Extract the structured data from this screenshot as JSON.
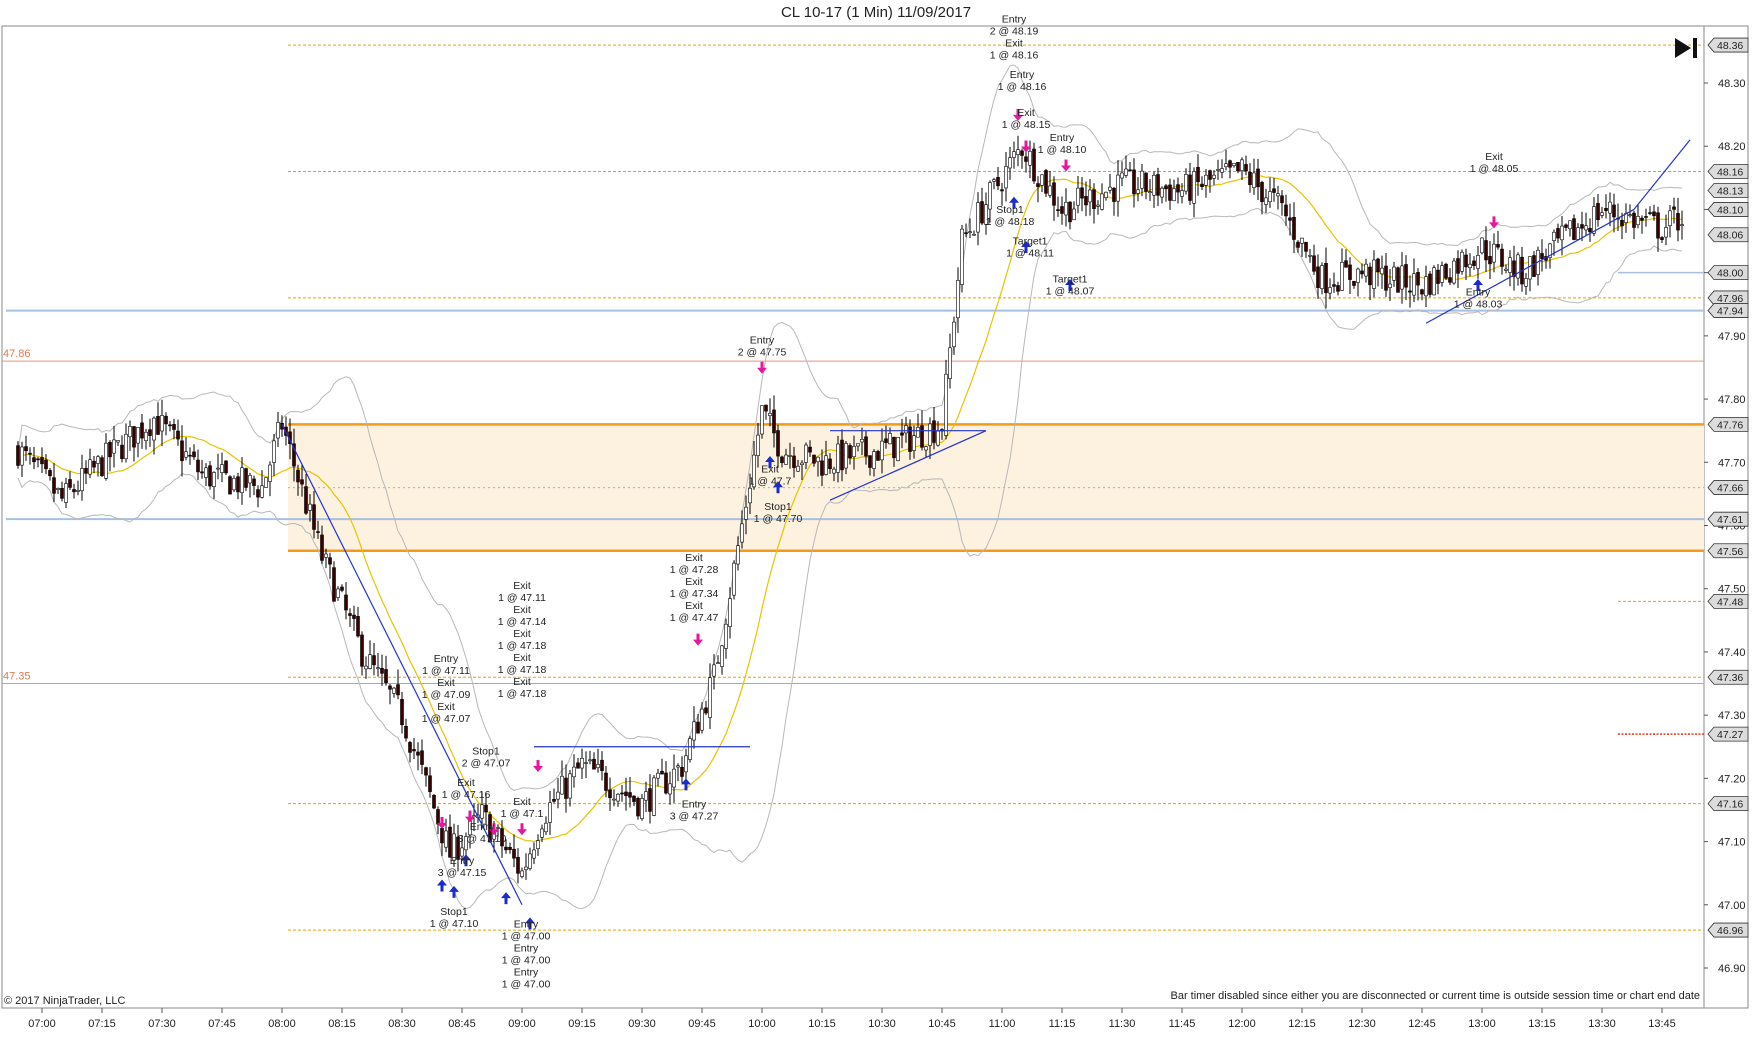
{
  "window": {
    "title": "CL 10-17 (1 Min)  11/09/2017",
    "copyright": "© 2017 NinjaTrader, LLC",
    "bar_timer_note": "Bar timer disabled since either you are disconnected or current time is outside session time or chart end date"
  },
  "colors": {
    "up_candle": "#ffffff",
    "down_candle": "#3a0000",
    "wick": "#000000",
    "bollinger": "#b8b8b8",
    "ma": "#e6c400",
    "trendline": "#2233cc",
    "entry_arrow_down": "#e6169f",
    "entry_arrow_up": "#1a2ccc",
    "zone_fill": "#fdf1e0",
    "zone_border": "#f29a1a",
    "level_orange_dotted": "#e8a400",
    "level_red_solid": "#e8957a",
    "level_blue": "#a8c0e0"
  },
  "chart_data": {
    "type": "candlestick",
    "title": "CL 10-17 (1 Min)  11/09/2017",
    "xlabel": "",
    "ylabel": "",
    "x_range": [
      "06:54",
      "14:00"
    ],
    "ylim": [
      46.86,
      48.39
    ],
    "x_ticks": [
      "07:00",
      "07:15",
      "07:30",
      "07:45",
      "08:00",
      "08:15",
      "08:30",
      "08:45",
      "09:00",
      "09:15",
      "09:30",
      "09:45",
      "10:00",
      "10:15",
      "10:30",
      "10:45",
      "11:00",
      "11:15",
      "11:30",
      "11:45",
      "12:00",
      "12:15",
      "12:30",
      "12:45",
      "13:00",
      "13:15",
      "13:30",
      "13:45"
    ],
    "y_ticks": [
      "46.90",
      "47.00",
      "47.10",
      "47.20",
      "47.30",
      "47.40",
      "47.50",
      "47.60",
      "47.70",
      "47.80",
      "47.90",
      "48.00",
      "48.10",
      "48.20",
      "48.30"
    ],
    "price_keypoints": [
      [
        "06:54",
        47.72
      ],
      [
        "07:05",
        47.64
      ],
      [
        "07:15",
        47.7
      ],
      [
        "07:28",
        47.77
      ],
      [
        "07:40",
        47.68
      ],
      [
        "07:55",
        47.66
      ],
      [
        "08:00",
        47.76
      ],
      [
        "08:10",
        47.55
      ],
      [
        "08:20",
        47.4
      ],
      [
        "08:30",
        47.3
      ],
      [
        "08:42",
        47.08
      ],
      [
        "08:50",
        47.14
      ],
      [
        "09:00",
        47.05
      ],
      [
        "09:05",
        47.14
      ],
      [
        "09:15",
        47.22
      ],
      [
        "09:30",
        47.16
      ],
      [
        "09:40",
        47.22
      ],
      [
        "09:48",
        47.36
      ],
      [
        "09:55",
        47.6
      ],
      [
        "10:00",
        47.78
      ],
      [
        "10:05",
        47.72
      ],
      [
        "10:15",
        47.7
      ],
      [
        "10:30",
        47.72
      ],
      [
        "10:45",
        47.76
      ],
      [
        "10:50",
        48.05
      ],
      [
        "11:00",
        48.15
      ],
      [
        "11:05",
        48.2
      ],
      [
        "11:15",
        48.1
      ],
      [
        "11:30",
        48.14
      ],
      [
        "11:45",
        48.13
      ],
      [
        "12:00",
        48.16
      ],
      [
        "12:10",
        48.1
      ],
      [
        "12:20",
        47.99
      ],
      [
        "12:30",
        48.0
      ],
      [
        "12:45",
        47.98
      ],
      [
        "13:00",
        48.04
      ],
      [
        "13:10",
        48.0
      ],
      [
        "13:20",
        48.05
      ],
      [
        "13:30",
        48.1
      ],
      [
        "13:45",
        48.07
      ],
      [
        "13:50",
        48.09
      ]
    ],
    "price_axis_markers": [
      {
        "value": 48.36,
        "label": "48.36",
        "style": "dotted-orange"
      },
      {
        "value": 48.16,
        "label": "48.16",
        "style": "dotted-orange"
      },
      {
        "value": 48.13,
        "label": "48.13",
        "style": "plain"
      },
      {
        "value": 48.1,
        "label": "48.10",
        "style": "plain"
      },
      {
        "value": 48.06,
        "label": "48.06",
        "style": "plain"
      },
      {
        "value": 48.0,
        "label": "48.00",
        "style": "blue"
      },
      {
        "value": 47.96,
        "label": "47.96",
        "style": "dotted-orange"
      },
      {
        "value": 47.94,
        "label": "47.94",
        "style": "blue"
      },
      {
        "value": 47.76,
        "label": "47.76",
        "style": "zone"
      },
      {
        "value": 47.66,
        "label": "47.66",
        "style": "plain"
      },
      {
        "value": 47.61,
        "label": "47.61",
        "style": "blue"
      },
      {
        "value": 47.56,
        "label": "47.56",
        "style": "zone"
      },
      {
        "value": 47.48,
        "label": "47.48",
        "style": "dotted-orange"
      },
      {
        "value": 47.36,
        "label": "47.36",
        "style": "dotted-orange"
      },
      {
        "value": 47.27,
        "label": "47.27",
        "style": "red-dotted"
      },
      {
        "value": 47.16,
        "label": "47.16",
        "style": "dotted-orange"
      },
      {
        "value": 46.96,
        "label": "46.96",
        "style": "dotted-orange"
      }
    ],
    "left_levels": [
      {
        "value": 47.86,
        "label": "47.86"
      },
      {
        "value": 47.35,
        "label": "47.35"
      }
    ],
    "zone": {
      "top": 47.76,
      "bottom": 47.56
    },
    "trendlines": [
      {
        "from": [
          "08:00",
          47.76
        ],
        "to": [
          "09:00",
          47.0
        ]
      },
      {
        "from": [
          "09:03",
          47.25
        ],
        "to": [
          "09:57",
          47.25
        ]
      },
      {
        "from": [
          "10:17",
          47.75
        ],
        "to": [
          "10:56",
          47.75
        ]
      },
      {
        "from": [
          "10:17",
          47.64
        ],
        "to": [
          "10:56",
          47.75
        ]
      },
      {
        "from": [
          "12:46",
          47.92
        ],
        "to": [
          "13:38",
          48.1
        ]
      },
      {
        "from": [
          "13:38",
          48.1
        ],
        "to": [
          "13:52",
          48.21
        ]
      }
    ],
    "trade_annotations": [
      {
        "time": "08:41",
        "price": 47.27,
        "text": [
          "Entry",
          "1 @ 47.11",
          "Exit",
          "1 @ 47.09",
          "Exit",
          "1 @ 47.07"
        ],
        "side": "above"
      },
      {
        "time": "08:46",
        "price": 47.15,
        "text": [
          "Exit",
          "1 @ 47.16"
        ],
        "side": "above"
      },
      {
        "time": "08:51",
        "price": 47.2,
        "text": [
          "Stop1",
          "2 @ 47.07"
        ],
        "side": "above"
      },
      {
        "time": "08:50",
        "price": 47.08,
        "text": [
          "Entry",
          "3 @ 47.10"
        ],
        "side": "above"
      },
      {
        "time": "08:45",
        "price": 47.08,
        "text": [
          "Entry",
          "3 @ 47.15"
        ],
        "side": "below"
      },
      {
        "time": "08:43",
        "price": 47.0,
        "text": [
          "Stop1",
          "1 @ 47.10"
        ],
        "side": "below"
      },
      {
        "time": "09:00",
        "price": 47.12,
        "text": [
          "Exit",
          "1 @ 47.1"
        ],
        "side": "above"
      },
      {
        "time": "09:00",
        "price": 47.31,
        "text": [
          "Exit",
          "1 @ 47.11",
          "Exit",
          "1 @ 47.14",
          "Exit",
          "1 @ 47.18",
          "Exit",
          "1 @ 47.18",
          "Exit",
          "1 @ 47.18"
        ],
        "side": "above"
      },
      {
        "time": "09:01",
        "price": 46.98,
        "text": [
          "Entry",
          "1 @ 47.00",
          "Entry",
          "1 @ 47.00",
          "Entry",
          "1 @ 47.00"
        ],
        "side": "below"
      },
      {
        "time": "09:43",
        "price": 47.43,
        "text": [
          "Exit",
          "1 @ 47.28",
          "Exit",
          "1 @ 47.34",
          "Exit",
          "1 @ 47.47"
        ],
        "side": "above"
      },
      {
        "time": "09:43",
        "price": 47.17,
        "text": [
          "Entry",
          "3 @ 47.27"
        ],
        "side": "below"
      },
      {
        "time": "10:00",
        "price": 47.85,
        "text": [
          "Entry",
          "2 @ 47.75"
        ],
        "side": "above"
      },
      {
        "time": "10:02",
        "price": 47.7,
        "text": [
          "Exit",
          "1 @ 47.7"
        ],
        "side": "below"
      },
      {
        "time": "10:04",
        "price": 47.64,
        "text": [
          "Stop1",
          "1 @ 47.70"
        ],
        "side": "below"
      },
      {
        "time": "11:03",
        "price": 48.32,
        "text": [
          "Entry",
          "2 @ 48.19",
          "Exit",
          "1 @ 48.16"
        ],
        "side": "above"
      },
      {
        "time": "11:05",
        "price": 48.27,
        "text": [
          "Entry",
          "1 @ 48.16"
        ],
        "side": "above"
      },
      {
        "time": "11:06",
        "price": 48.21,
        "text": [
          "Exit",
          "1 @ 48.15"
        ],
        "side": "above"
      },
      {
        "time": "11:15",
        "price": 48.17,
        "text": [
          "Entry",
          "1 @ 48.10"
        ],
        "side": "above"
      },
      {
        "time": "11:02",
        "price": 48.11,
        "text": [
          "Stop1",
          "1 @ 48.18"
        ],
        "side": "below"
      },
      {
        "time": "11:07",
        "price": 48.06,
        "text": [
          "Target1",
          "1 @ 48.11"
        ],
        "side": "below"
      },
      {
        "time": "11:17",
        "price": 48.0,
        "text": [
          "Target1",
          "1 @ 48.07"
        ],
        "side": "below"
      },
      {
        "time": "13:03",
        "price": 48.14,
        "text": [
          "Exit",
          "1 @ 48.05"
        ],
        "side": "above"
      },
      {
        "time": "12:59",
        "price": 47.98,
        "text": [
          "Entry",
          "1 @ 48.03"
        ],
        "side": "below"
      }
    ],
    "markers": [
      {
        "time": "08:40",
        "price": 47.12,
        "dir": "down"
      },
      {
        "time": "08:47",
        "price": 47.13,
        "dir": "down"
      },
      {
        "time": "08:53",
        "price": 47.11,
        "dir": "down"
      },
      {
        "time": "09:00",
        "price": 47.11,
        "dir": "down"
      },
      {
        "time": "09:04",
        "price": 47.21,
        "dir": "down"
      },
      {
        "time": "09:44",
        "price": 47.41,
        "dir": "down"
      },
      {
        "time": "10:00",
        "price": 47.84,
        "dir": "down"
      },
      {
        "time": "11:04",
        "price": 48.24,
        "dir": "down"
      },
      {
        "time": "11:06",
        "price": 48.19,
        "dir": "down"
      },
      {
        "time": "11:16",
        "price": 48.16,
        "dir": "down"
      },
      {
        "time": "13:03",
        "price": 48.07,
        "dir": "down"
      },
      {
        "time": "08:40",
        "price": 47.04,
        "dir": "up"
      },
      {
        "time": "08:43",
        "price": 47.03,
        "dir": "up"
      },
      {
        "time": "08:46",
        "price": 47.08,
        "dir": "up"
      },
      {
        "time": "08:56",
        "price": 47.02,
        "dir": "up"
      },
      {
        "time": "09:02",
        "price": 46.98,
        "dir": "up"
      },
      {
        "time": "09:41",
        "price": 47.2,
        "dir": "up"
      },
      {
        "time": "10:02",
        "price": 47.71,
        "dir": "up"
      },
      {
        "time": "10:04",
        "price": 47.67,
        "dir": "up"
      },
      {
        "time": "11:03",
        "price": 48.12,
        "dir": "up"
      },
      {
        "time": "11:06",
        "price": 48.05,
        "dir": "up"
      },
      {
        "time": "11:17",
        "price": 47.99,
        "dir": "up"
      },
      {
        "time": "12:59",
        "price": 47.99,
        "dir": "up"
      }
    ]
  }
}
